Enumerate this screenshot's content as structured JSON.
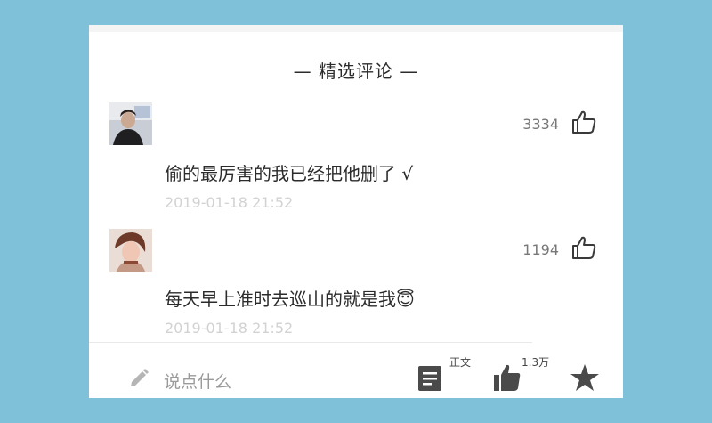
{
  "section_title": "— 精选评论 —",
  "comments": [
    {
      "avatar": "man-portrait-avatar",
      "likes": "3334",
      "like_icon": "thumbs-up-outline-icon",
      "text": "偷的最厉害的我已经把他删了 √",
      "timestamp": "2019-01-18 21:52"
    },
    {
      "avatar": "woman-portrait-avatar",
      "likes": "1194",
      "like_icon": "thumbs-up-outline-icon",
      "text": "每天早上准时去巡山的就是我😇",
      "timestamp": "2019-01-18 21:52"
    }
  ],
  "bottom_bar": {
    "input_placeholder": "说点什么",
    "doc_label": "正文",
    "like_total": "1.3万",
    "icons": [
      "pencil-icon",
      "document-icon",
      "thumbs-up-filled-icon",
      "star-icon"
    ]
  },
  "colors": {
    "background": "#7fc1d9",
    "card": "#ffffff",
    "text": "#2b2b2b",
    "muted": "#9a9a9a",
    "timestamp": "#d2d2d2",
    "icon": "#4a4a4a"
  }
}
